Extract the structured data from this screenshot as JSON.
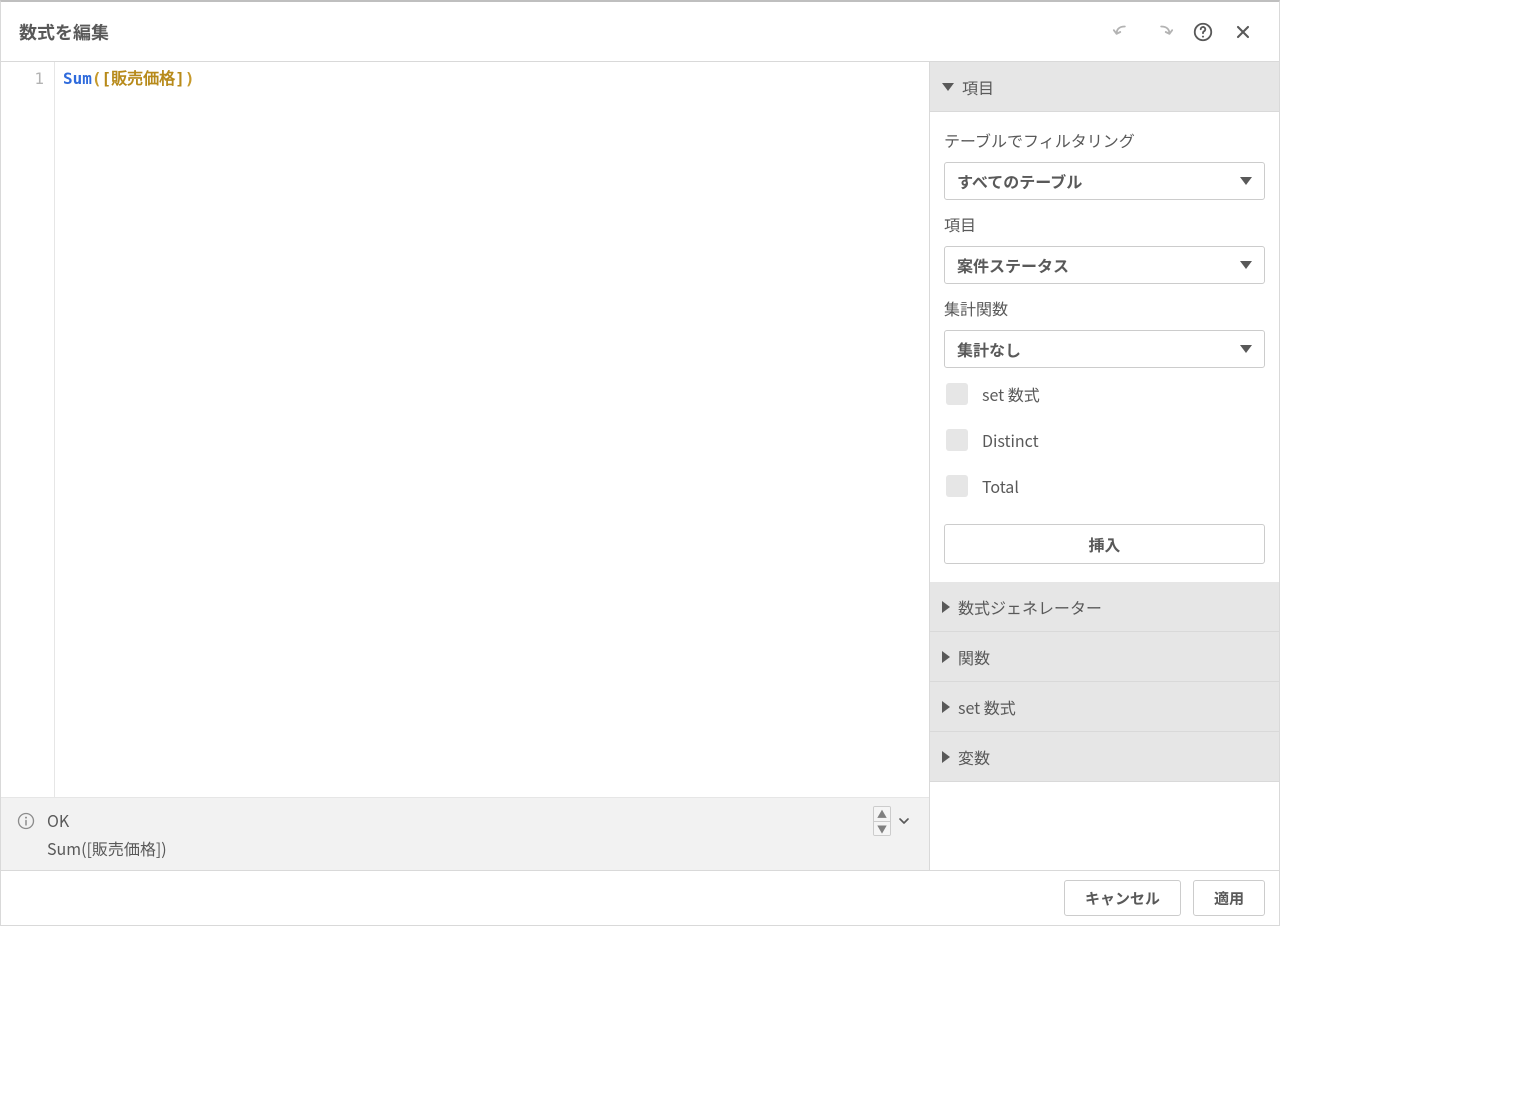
{
  "header": {
    "title": "数式を編集"
  },
  "editor": {
    "line_number": "1",
    "func": "Sum",
    "paren_open": "(",
    "field": "[販売価格]",
    "paren_close": ")"
  },
  "status": {
    "ok_label": "OK",
    "expression": "Sum([販売価格])"
  },
  "side": {
    "sections": {
      "fields": {
        "title": "項目",
        "filter_label": "テーブルでフィルタリング",
        "filter_value": "すべてのテーブル",
        "field_label": "項目",
        "field_value": "案件ステータス",
        "agg_label": "集計関数",
        "agg_value": "集計なし",
        "check_set": "set 数式",
        "check_distinct": "Distinct",
        "check_total": "Total",
        "insert_label": "挿入"
      },
      "generator": {
        "title": "数式ジェネレーター"
      },
      "functions": {
        "title": "関数"
      },
      "set_expr": {
        "title": "set 数式"
      },
      "variables": {
        "title": "変数"
      }
    }
  },
  "footer": {
    "cancel": "キャンセル",
    "apply": "適用"
  }
}
